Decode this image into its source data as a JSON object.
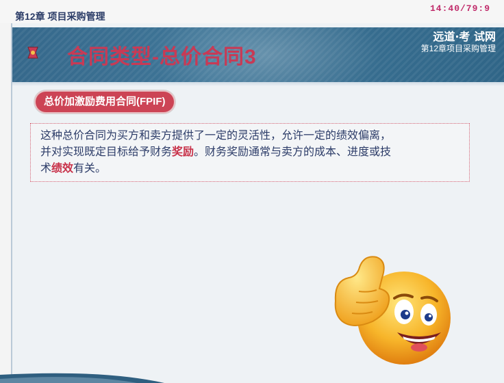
{
  "header": {
    "chapter_label": "第12章 项目采购管理",
    "clock": "14:40/79:9"
  },
  "banner": {
    "title": "合同类型-总价合同3",
    "logo_text": "远道·考 试网",
    "subtitle": "第12章项目采购管理"
  },
  "section": {
    "pill_label": "总价加激励费用合同(FPIF)"
  },
  "body": {
    "p1": "这种总价合同为买方和卖方提供了一定的灵活性，允许一定的绩效偏离，",
    "p2a": "并对实现既定目标给予财务",
    "p2_highlight": "奖励",
    "p2b": "。财务奖励通常与卖方的成本、进度或技",
    "p3a": "术",
    "p3_highlight": "绩效",
    "p3b": "有关。"
  },
  "colors": {
    "banner_blue": "#3f7698",
    "accent_red": "#cc4455",
    "text_navy": "#2c3c68"
  },
  "decorations": {
    "emoji": "thumbs-up-smiley-icon"
  }
}
